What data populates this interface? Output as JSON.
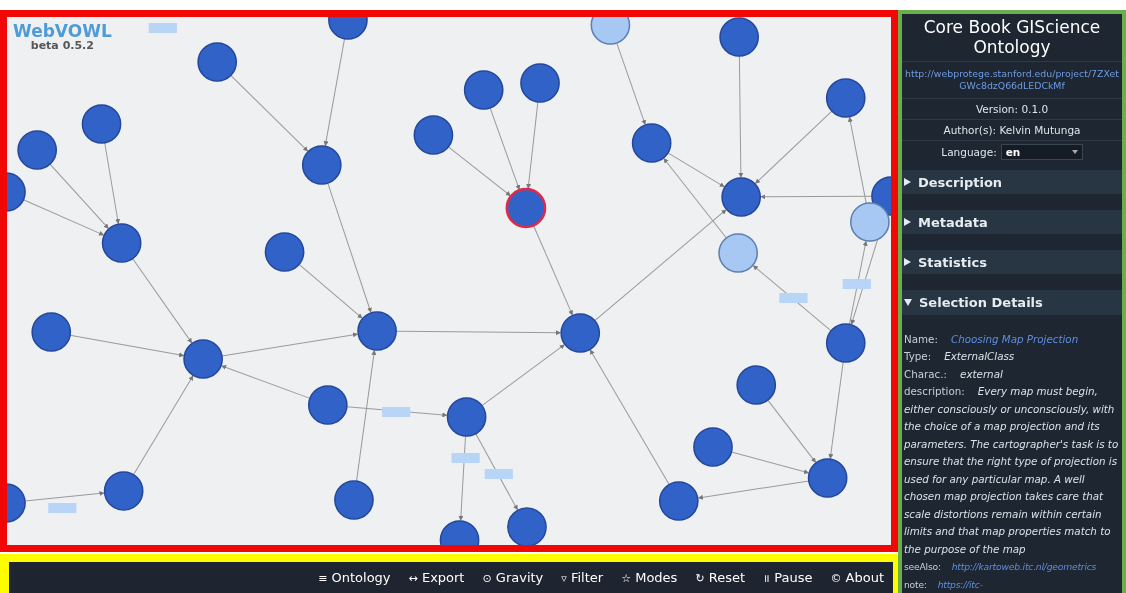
{
  "logo": {
    "name": "WebVOWL",
    "version": "beta 0.5.2"
  },
  "graph": {
    "nodes": [
      {
        "kind": "class",
        "selected": false
      },
      {
        "kind": "class",
        "selected": false
      },
      {
        "kind": "external",
        "selected": false
      },
      {
        "kind": "class",
        "selected": false
      },
      {
        "kind": "class",
        "selected": false
      },
      {
        "kind": "class",
        "selected": false
      },
      {
        "kind": "class",
        "selected": false
      },
      {
        "kind": "class",
        "selected": false
      },
      {
        "kind": "class",
        "selected": false
      },
      {
        "kind": "class",
        "selected": false
      },
      {
        "kind": "class",
        "selected": false
      },
      {
        "kind": "class",
        "selected": false
      },
      {
        "kind": "class",
        "selected": false
      },
      {
        "kind": "class",
        "selected": true
      },
      {
        "kind": "class",
        "selected": false
      },
      {
        "kind": "class",
        "selected": false
      },
      {
        "kind": "class",
        "selected": false
      },
      {
        "kind": "class",
        "selected": false
      },
      {
        "kind": "external",
        "selected": false
      },
      {
        "kind": "external",
        "selected": false
      },
      {
        "kind": "class",
        "selected": false
      },
      {
        "kind": "class",
        "selected": false
      },
      {
        "kind": "class",
        "selected": false
      },
      {
        "kind": "class",
        "selected": false
      },
      {
        "kind": "class",
        "selected": false
      },
      {
        "kind": "class",
        "selected": false
      },
      {
        "kind": "class",
        "selected": false
      },
      {
        "kind": "class",
        "selected": false
      },
      {
        "kind": "class",
        "selected": false
      },
      {
        "kind": "class",
        "selected": false
      },
      {
        "kind": "class",
        "selected": false
      },
      {
        "kind": "class",
        "selected": false
      },
      {
        "kind": "class",
        "selected": false
      },
      {
        "kind": "class",
        "selected": false
      },
      {
        "kind": "class",
        "selected": false
      },
      {
        "kind": "class",
        "selected": false
      }
    ]
  },
  "toolbar": [
    {
      "icon": "≡",
      "label": "Ontology"
    },
    {
      "icon": "↔",
      "label": "Export"
    },
    {
      "icon": "⊙",
      "label": "Gravity"
    },
    {
      "icon": "▿",
      "label": "Filter"
    },
    {
      "icon": "☆",
      "label": "Modes"
    },
    {
      "icon": "↻",
      "label": "Reset"
    },
    {
      "icon": "॥",
      "label": "Pause"
    },
    {
      "icon": "©",
      "label": "About"
    }
  ],
  "sidebar": {
    "title": "Core Book GIScience Ontology",
    "iri": "http://webprotege.stanford.edu/project/7ZXetGWc8dzQ66dLEDCkMf",
    "version": "Version: 0.1.0",
    "authors": "Author(s): Kelvin Mutunga",
    "language": {
      "label": "Language:",
      "value": "en"
    },
    "sections": [
      {
        "label": "Description",
        "expanded": false
      },
      {
        "label": "Metadata",
        "expanded": false
      },
      {
        "label": "Statistics",
        "expanded": false
      },
      {
        "label": "Selection Details",
        "expanded": true
      }
    ],
    "details": [
      {
        "key": "Name:",
        "value": "Choosing Map Projection",
        "kind": "link"
      },
      {
        "key": "Type:",
        "value": "ExternalClass",
        "kind": "text"
      },
      {
        "key": "Charac.:",
        "value": "external",
        "kind": "text"
      },
      {
        "key": "description:",
        "value": "Every map must begin, either consciously or unconsciously, with the choice of a map projection and its parameters. The cartographer's task is to ensure that the right type of projection is used for any particular map. A well chosen map projection takes care that scale distortions remain within certain limits and that map properties match to the purpose of the map",
        "kind": "text"
      },
      {
        "key": "seeAlso:",
        "value": "http://kartoweb.itc.nl/geometrics",
        "kind": "link"
      },
      {
        "key": "note:",
        "value": "https://itc-",
        "kind": "link"
      }
    ]
  }
}
